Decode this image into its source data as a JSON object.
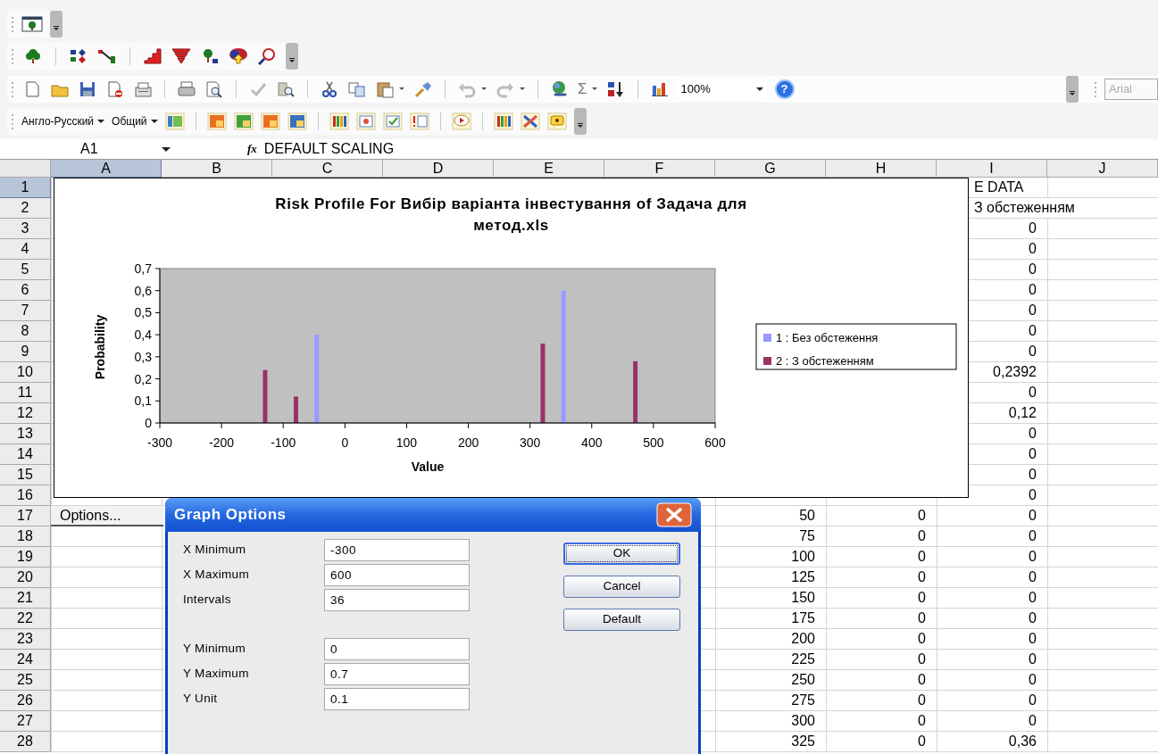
{
  "toolbars": {
    "translator_dropdown": "Англо-Русский",
    "style_dropdown": "Общий",
    "autosum_symbol": "Σ",
    "zoom": "100%",
    "help_symbol": "?",
    "font_box": "Arial"
  },
  "formula_bar": {
    "name_box": "A1",
    "function_label": "fx",
    "content": "DEFAULT SCALING"
  },
  "sheet": {
    "columns": [
      {
        "label": "A",
        "selected": true
      },
      {
        "label": "B",
        "selected": false
      },
      {
        "label": "C",
        "selected": false
      },
      {
        "label": "D",
        "selected": false
      },
      {
        "label": "E",
        "selected": false
      },
      {
        "label": "F",
        "selected": false
      },
      {
        "label": "G",
        "selected": false
      },
      {
        "label": "H",
        "selected": false
      },
      {
        "label": "I",
        "selected": false
      },
      {
        "label": "J",
        "selected": false
      }
    ],
    "rows": [
      {
        "header": "1",
        "selected": true,
        "I": "E DATA"
      },
      {
        "header": "2",
        "selected": false,
        "I": "З обстеженням"
      },
      {
        "header": "3",
        "selected": false,
        "I": "0"
      },
      {
        "header": "4",
        "selected": false,
        "I": "0"
      },
      {
        "header": "5",
        "selected": false,
        "I": "0"
      },
      {
        "header": "6",
        "selected": false,
        "I": "0"
      },
      {
        "header": "7",
        "selected": false,
        "I": "0"
      },
      {
        "header": "8",
        "selected": false,
        "I": "0"
      },
      {
        "header": "9",
        "selected": false,
        "I": "0"
      },
      {
        "header": "10",
        "selected": false,
        "I": "0,2392"
      },
      {
        "header": "11",
        "selected": false,
        "I": "0"
      },
      {
        "header": "12",
        "selected": false,
        "I": "0,12"
      },
      {
        "header": "13",
        "selected": false,
        "I": "0"
      },
      {
        "header": "14",
        "selected": false,
        "I": "0"
      },
      {
        "header": "15",
        "selected": false,
        "I": "0"
      },
      {
        "header": "16",
        "selected": false,
        "I": "0"
      },
      {
        "header": "17",
        "selected": false,
        "G": "50",
        "H": "0",
        "I": "0"
      },
      {
        "header": "18",
        "selected": false,
        "G": "75",
        "H": "0",
        "I": "0"
      },
      {
        "header": "19",
        "selected": false,
        "G": "100",
        "H": "0",
        "I": "0"
      },
      {
        "header": "20",
        "selected": false,
        "G": "125",
        "H": "0",
        "I": "0"
      },
      {
        "header": "21",
        "selected": false,
        "G": "150",
        "H": "0",
        "I": "0"
      },
      {
        "header": "22",
        "selected": false,
        "G": "175",
        "H": "0",
        "I": "0"
      },
      {
        "header": "23",
        "selected": false,
        "G": "200",
        "H": "0",
        "I": "0"
      },
      {
        "header": "24",
        "selected": false,
        "G": "225",
        "H": "0",
        "I": "0"
      },
      {
        "header": "25",
        "selected": false,
        "G": "250",
        "H": "0",
        "I": "0"
      },
      {
        "header": "26",
        "selected": false,
        "G": "275",
        "H": "0",
        "I": "0"
      },
      {
        "header": "27",
        "selected": false,
        "G": "300",
        "H": "0",
        "I": "0"
      },
      {
        "header": "28",
        "selected": false,
        "G": "325",
        "H": "0",
        "I": "0,36"
      }
    ]
  },
  "options_button": "Options...",
  "chart": {
    "chart_data": {
      "type": "bar",
      "title": "Risk Profile For Вибір варіанта інвестування of Задача для метод.xls",
      "xlabel": "Value",
      "ylabel": "Probability",
      "x": [
        -125,
        -75,
        -50,
        325,
        350,
        475
      ],
      "series": [
        {
          "name": "1 : Без обстеження",
          "color": "#9999ff",
          "values": [
            null,
            null,
            0.4,
            null,
            0.6,
            null
          ]
        },
        {
          "name": "2 : З обстеженням",
          "color": "#993366",
          "values": [
            0.24,
            0.12,
            null,
            0.36,
            null,
            0.28
          ]
        }
      ],
      "legend": "right",
      "xlim": [
        -300,
        600
      ],
      "ylim": [
        0,
        0.7
      ],
      "xticks": [
        {
          "value": -300,
          "label": "-300"
        },
        {
          "value": -200,
          "label": "-200"
        },
        {
          "value": -100,
          "label": "-100"
        },
        {
          "value": 0,
          "label": "0"
        },
        {
          "value": 100,
          "label": "100"
        },
        {
          "value": 200,
          "label": "200"
        },
        {
          "value": 300,
          "label": "300"
        },
        {
          "value": 400,
          "label": "400"
        },
        {
          "value": 500,
          "label": "500"
        },
        {
          "value": 600,
          "label": "600"
        }
      ],
      "yticks": [
        {
          "value": 0,
          "label": "0"
        },
        {
          "value": 0.1,
          "label": "0,1"
        },
        {
          "value": 0.2,
          "label": "0,2"
        },
        {
          "value": 0.3,
          "label": "0,3"
        },
        {
          "value": 0.4,
          "label": "0,4"
        },
        {
          "value": 0.5,
          "label": "0,5"
        },
        {
          "value": 0.6,
          "label": "0,6"
        },
        {
          "value": 0.7,
          "label": "0,7"
        }
      ]
    }
  },
  "dialog": {
    "title": "Graph Options",
    "fields": [
      {
        "label": "X Minimum",
        "value": "-300"
      },
      {
        "label": "X Maximum",
        "value": "600"
      },
      {
        "label": "Intervals",
        "value": "36"
      },
      {
        "label": "Y Minimum",
        "value": "0"
      },
      {
        "label": "Y Maximum",
        "value": "0.7"
      },
      {
        "label": "Y Unit",
        "value": "0.1"
      }
    ],
    "buttons": [
      {
        "label": "OK",
        "selected": true
      },
      {
        "label": "Cancel",
        "selected": false
      },
      {
        "label": "Default",
        "selected": false
      }
    ]
  }
}
